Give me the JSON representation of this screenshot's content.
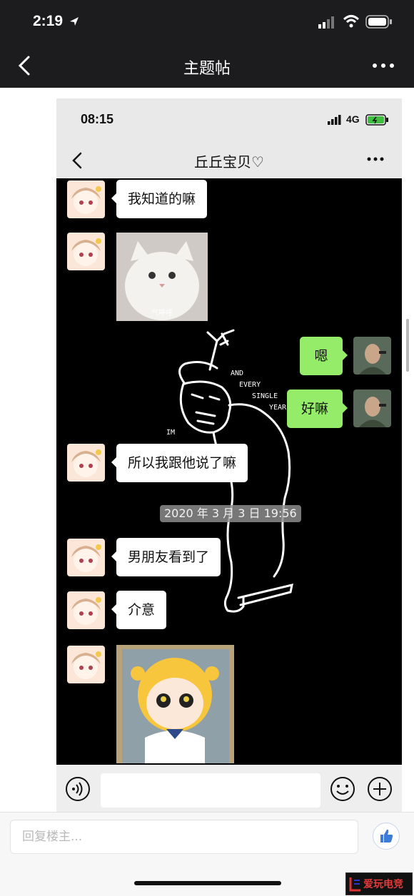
{
  "outer": {
    "time": "2:19",
    "title": "主题帖",
    "reply_placeholder": "回复楼主..."
  },
  "screenshot": {
    "time": "08:15",
    "network": "4G",
    "chat_title": "丘丘宝贝♡",
    "messages": [
      {
        "side": "left",
        "type": "text",
        "text": "我知道的嘛"
      },
      {
        "side": "left",
        "type": "sticker",
        "caption": "气呼呼"
      },
      {
        "side": "right",
        "type": "text",
        "text": "嗯"
      },
      {
        "side": "right",
        "type": "text",
        "text": "好嘛"
      },
      {
        "side": "left",
        "type": "text",
        "text": "所以我跟他说了嘛"
      },
      {
        "side": "left",
        "type": "text",
        "text": "男朋友看到了"
      },
      {
        "side": "left",
        "type": "text",
        "text": "介意"
      },
      {
        "side": "left",
        "type": "sticker",
        "caption": ""
      }
    ],
    "timestamp": "2020 年 3 月 3 日 19:56",
    "wallpaper_text": [
      "AND",
      "EVERY",
      "SINGLE",
      "YEAR",
      "IM"
    ]
  },
  "watermark": "爱玩电竞",
  "colors": {
    "accent_green": "#95ec69",
    "dark_bar": "#1c1c1e",
    "like_blue": "#3d7bd9"
  },
  "icons": [
    "back-icon",
    "more-icon",
    "location-arrow-icon",
    "signal-icon",
    "wifi-icon",
    "battery-icon",
    "voice-icon",
    "emoji-icon",
    "plus-icon",
    "thumbs-up-icon"
  ]
}
